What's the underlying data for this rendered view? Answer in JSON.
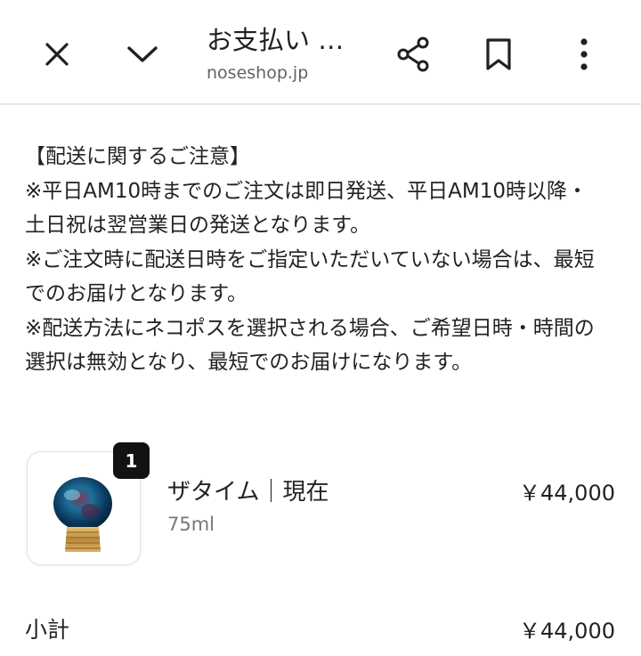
{
  "header": {
    "title": "お支払い …",
    "url": "noseshop.jp",
    "icons": {
      "close": "close-icon",
      "minimize": "chevron-down-icon",
      "share": "share-icon",
      "bookmark": "bookmark-icon",
      "menu": "more-vert-icon"
    }
  },
  "notice": {
    "lines": [
      "【配送に関するご注意】",
      "※平日AM10時までのご注文は即日発送、平日AM10時以降・",
      "土日祝は翌営業日の発送となります。",
      "※ご注文時に配送日時をご指定いただいていない場合は、最短",
      "でのお届けとなります。",
      "※配送方法にネコポスを選択される場合、ご希望日時・時間の",
      "選択は無効となり、最短でのお届けになります。"
    ]
  },
  "order": {
    "item": {
      "quantity": "1",
      "name": "ザタイム｜現在",
      "variant": "75ml",
      "price": "￥44,000"
    },
    "subtotal": {
      "label": "小計",
      "value": "￥44,000"
    }
  },
  "colors": {
    "text": "#1f1f1f",
    "muted": "#777777",
    "badge_bg": "#121212",
    "divider": "#e6e6e6"
  }
}
